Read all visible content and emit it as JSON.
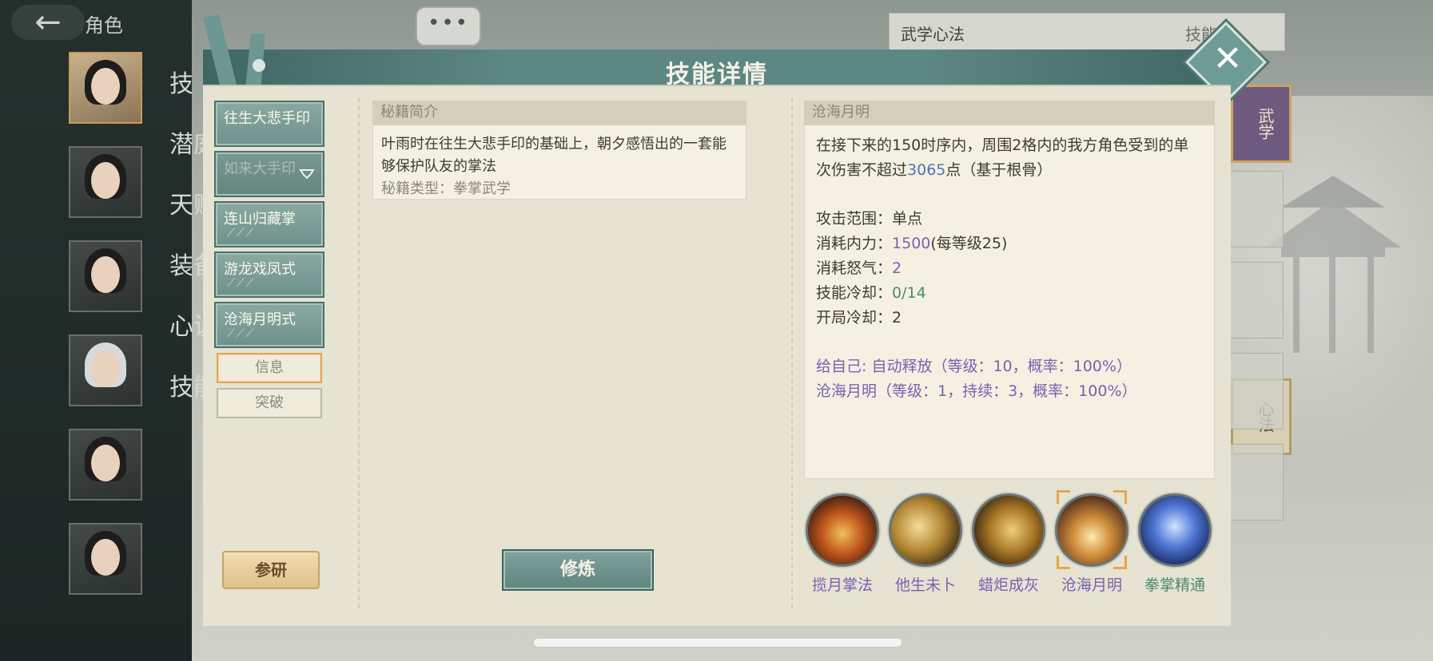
{
  "background": {
    "back_title": "角色",
    "chat_dots": "•••",
    "side_labels": [
      "技",
      "潜庭",
      "天赋",
      "装备",
      "心诀",
      "技能"
    ],
    "right_panel_title": "武学心法",
    "right_panel_suffix": "技能",
    "wuxue_tag": "武学",
    "xinfa_tag": "心法"
  },
  "modal": {
    "title": "技能详情",
    "close_icon": "close-icon",
    "skill_list": [
      {
        "name": "往生大悲手印",
        "ticks": "",
        "locked": false
      },
      {
        "name": "如来大手印",
        "ticks": "",
        "locked": true
      },
      {
        "name": "连山归藏掌",
        "ticks": "⟋⟋⟋",
        "locked": false
      },
      {
        "name": "游龙戏凤式",
        "ticks": "⟋⟋⟋",
        "locked": false
      },
      {
        "name": "沧海月明式",
        "ticks": "⟋⟋⟋",
        "locked": false
      }
    ],
    "tabs": [
      "信息",
      "突破"
    ],
    "research_button": "参研",
    "train_button": "修炼",
    "intro": {
      "header": "秘籍简介",
      "text": "叶雨时在往生大悲手印的基础上，朝夕感悟出的一套能够保护队友的掌法",
      "type_label": "秘籍类型：",
      "type_value": "拳掌武学"
    },
    "detail": {
      "header": "沧海月明",
      "desc_prefix": "在接下来的150时序内，周围2格内的我方角色受到的单次伤害不超过",
      "desc_value": "3065",
      "desc_suffix": "点（基于根骨）",
      "range_label": "攻击范围：",
      "range_value": "单点",
      "mp_label": "消耗内力：",
      "mp_value": "1500",
      "mp_extra": "(每等级25)",
      "rage_label": "消耗怒气：",
      "rage_value": "2",
      "cd_label": "技能冷却：",
      "cd_value": "0/14",
      "start_cd_label": "开局冷却：",
      "start_cd_value": "2",
      "self_label": "给自己: ",
      "self_effect_1": "自动释放（等级：10，概率：100%）",
      "self_effect_2": "沧海月明（等级：1，持续：3，概率：100%）"
    },
    "skill_icons": [
      {
        "label": "揽月掌法",
        "icon": "flame-aura-icon",
        "selected": false
      },
      {
        "label": "他生未卜",
        "icon": "dash-figure-icon",
        "selected": false
      },
      {
        "label": "蜡炬成灰",
        "icon": "golden-beast-icon",
        "selected": false
      },
      {
        "label": "沧海月明",
        "icon": "light-pillar-icon",
        "selected": true
      },
      {
        "label": "拳掌精通",
        "icon": "blue-spirit-icon",
        "selected": false
      }
    ]
  }
}
